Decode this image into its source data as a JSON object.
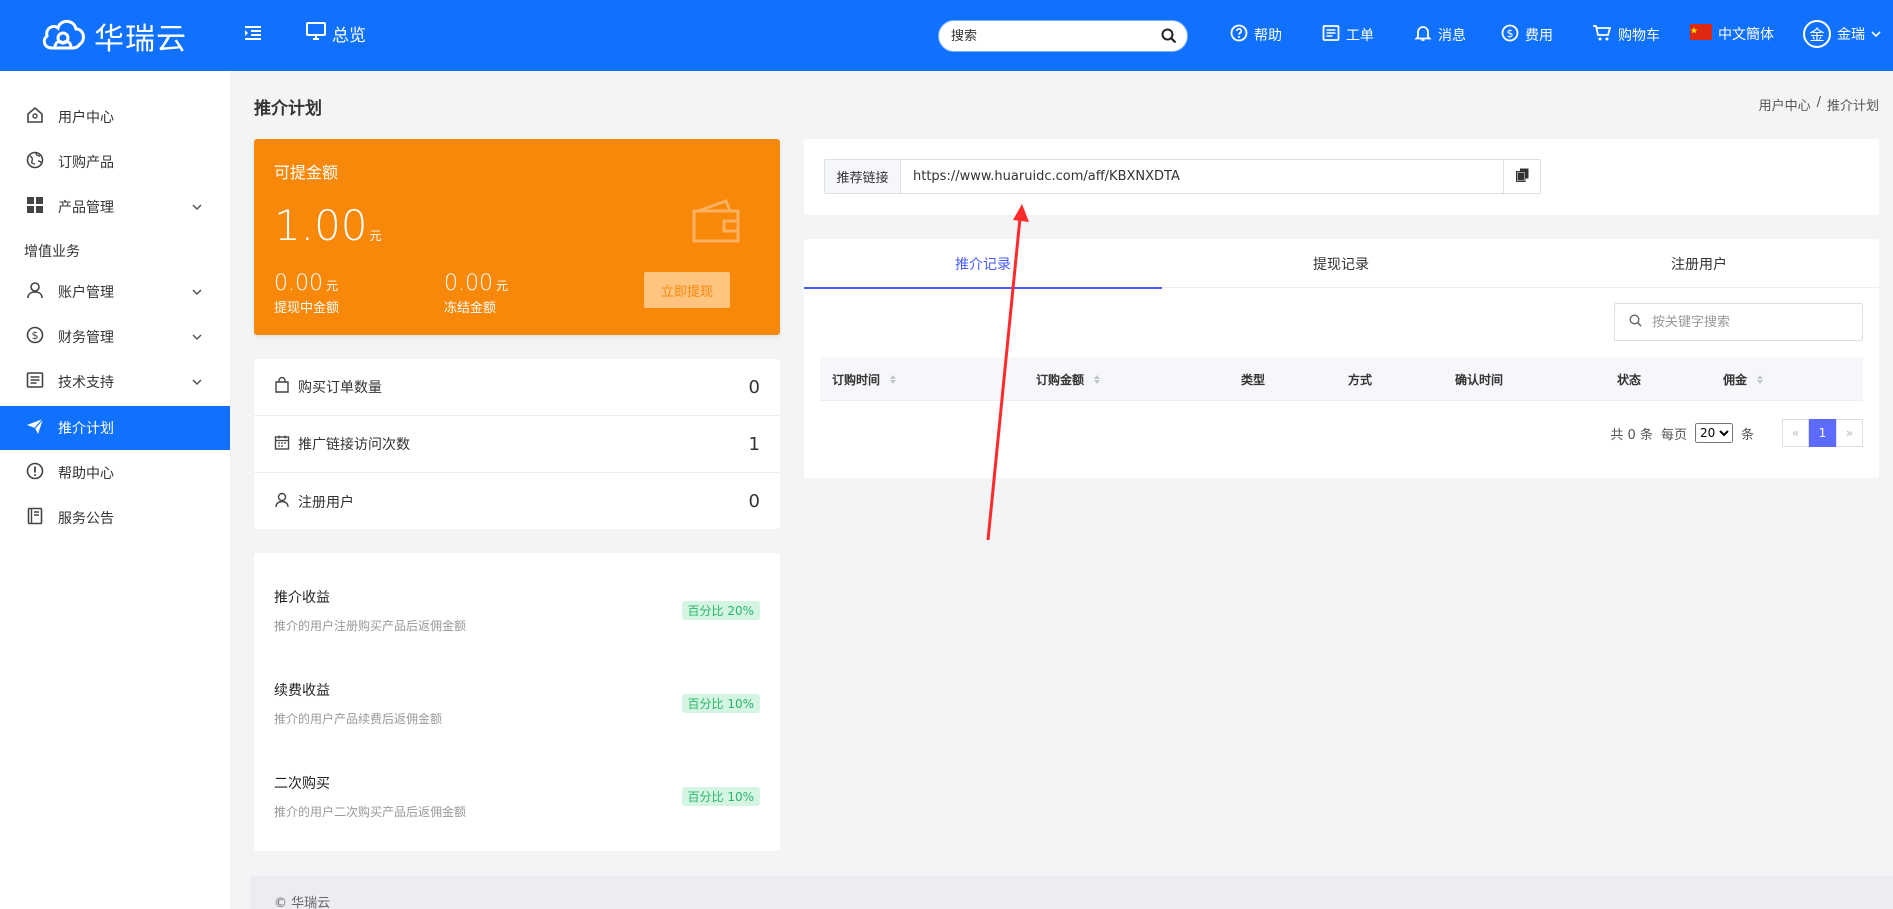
{
  "header": {
    "logo_text": "华瑞云",
    "overview_label": "总览",
    "search_placeholder": "搜索",
    "nav": {
      "help": "帮助",
      "ticket": "工单",
      "message": "消息",
      "fees": "费用",
      "cart": "购物车",
      "language": "中文簡体",
      "user_avatar": "金",
      "user_name": "金瑞"
    }
  },
  "sidebar": {
    "items": [
      {
        "label": "用户中心"
      },
      {
        "label": "订购产品"
      },
      {
        "label": "产品管理"
      },
      {
        "label": "增值业务"
      },
      {
        "label": "账户管理"
      },
      {
        "label": "财务管理"
      },
      {
        "label": "技术支持"
      },
      {
        "label": "推介计划"
      },
      {
        "label": "帮助中心"
      },
      {
        "label": "服务公告"
      }
    ]
  },
  "page": {
    "title": "推介计划",
    "breadcrumb": [
      "用户中心",
      "/",
      "推介计划"
    ]
  },
  "balance_card": {
    "title": "可提金额",
    "amount": "1.00",
    "unit": "元",
    "withdrawing_amount": "0.00",
    "withdrawing_label": "提现中金额",
    "frozen_amount": "0.00",
    "frozen_label": "冻结金额",
    "withdraw_button": "立即提现"
  },
  "stats": [
    {
      "label": "购买订单数量",
      "value": "0"
    },
    {
      "label": "推广链接访问次数",
      "value": "1"
    },
    {
      "label": "注册用户",
      "value": "0"
    }
  ],
  "income": [
    {
      "title": "推介收益",
      "desc": "推介的用户注册购买产品后返佣金额",
      "badge": "百分比 20%"
    },
    {
      "title": "续费收益",
      "desc": "推介的用户产品续费后返佣金额",
      "badge": "百分比 10%"
    },
    {
      "title": "二次购买",
      "desc": "推介的用户二次购买产品后返佣金额",
      "badge": "百分比 10%"
    }
  ],
  "referral_link": {
    "label": "推荐链接",
    "url": "https://www.huaruidc.com/aff/KBXNXDTA"
  },
  "records": {
    "tabs": [
      "推介记录",
      "提现记录",
      "注册用户"
    ],
    "active_tab": 0,
    "search_placeholder": "按关键字搜索",
    "columns": [
      "订购时间",
      "订购金额",
      "类型",
      "方式",
      "确认时间",
      "状态",
      "佣金"
    ],
    "rows": [],
    "pager": {
      "total_text": "共 0 条",
      "per_page_label": "每页",
      "per_page_value": "20",
      "per_page_suffix": "条",
      "prev": "«",
      "current": "1",
      "next": "»"
    }
  },
  "footer": {
    "copyright": "© 华瑞云"
  },
  "colors": {
    "primary": "#1171ff",
    "orange": "#f7880a",
    "tab_active": "#4a5cff",
    "badge_green": "#2bb56a",
    "arrow_red": "#ff2a2a"
  }
}
